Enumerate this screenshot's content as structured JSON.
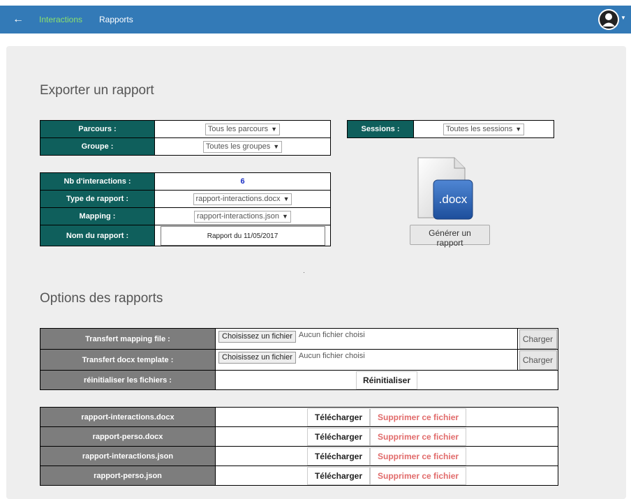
{
  "navbar": {
    "back_icon": "←",
    "links": [
      "Interactions",
      "Rapports"
    ],
    "active_color": "#8be06d",
    "bg_color": "#337ab7"
  },
  "export": {
    "title": "Exporter un rapport",
    "parcours_label": "Parcours :",
    "parcours_value": "Tous les parcours",
    "groupe_label": "Groupe :",
    "groupe_value": "Toutes les groupes",
    "sessions_label": "Sessions :",
    "sessions_value": "Toutes les sessions",
    "nb_label": "Nb d'interactions :",
    "nb_value": "6",
    "type_label": "Type de rapport :",
    "type_value": "rapport-interactions.docx",
    "mapping_label": "Mapping :",
    "mapping_value": "rapport-interactions.json",
    "nom_label": "Nom du rapport :",
    "nom_value": "Rapport du 11/05/2017",
    "doc_icon_text": ".docx",
    "generate_label": "Générer un rapport"
  },
  "options": {
    "title": "Options des rapports",
    "mapping_label": "Transfert mapping file :",
    "docx_label": "Transfert docx template :",
    "reset_label": "réinitialiser les fichiers :",
    "choose_label": "Choisissez un fichier",
    "no_file": "Aucun fichier choisi",
    "charger_label": "Charger",
    "reset_button": "Réinitialiser"
  },
  "files": {
    "download_label": "Télécharger",
    "delete_label": "Supprimer ce fichier",
    "rows": [
      "rapport-interactions.docx",
      "rapport-perso.docx",
      "rapport-interactions.json",
      "rapport-perso.json"
    ]
  }
}
